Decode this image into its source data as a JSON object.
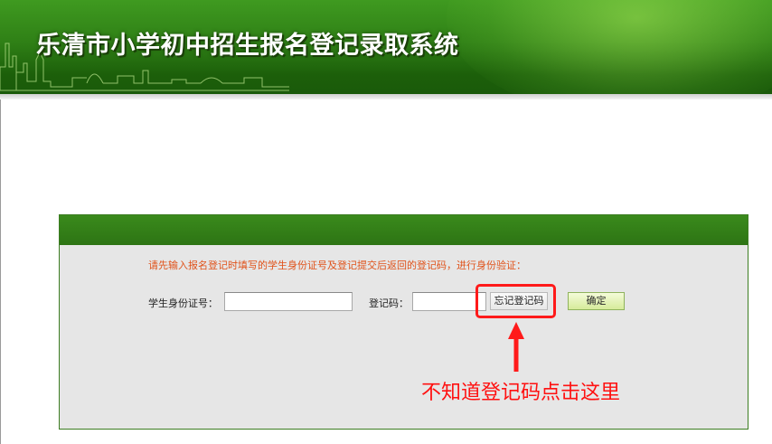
{
  "header": {
    "title": "乐清市小学初中招生报名登记录取系统"
  },
  "form": {
    "instruction": "请先输入报名登记时填写的学生身份证号及登记提交后返回的登记码，进行身份验证：",
    "id_label": "学生身份证号：",
    "id_value": "",
    "code_label": "登记码：",
    "code_value": "",
    "forgot_button": "忘记登记码",
    "confirm_button": "确定"
  },
  "annotation": {
    "hint": "不知道登记码点击这里",
    "color": "#ff1111"
  },
  "colors": {
    "banner_green": "#2f8016",
    "panel_border": "#3c7d22",
    "panel_background": "#e6e6e6",
    "instruction_orange": "#e0521a"
  }
}
